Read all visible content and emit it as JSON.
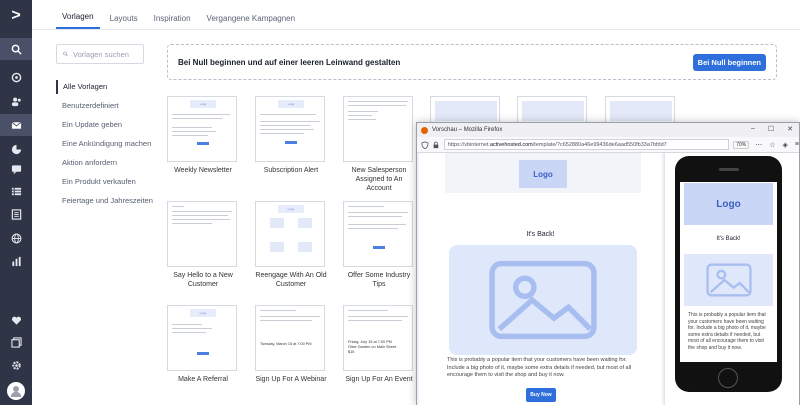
{
  "nav": {
    "logo_glyph": ">",
    "icons": [
      "search-icon",
      "rocket-icon",
      "contacts-icon",
      "mail-icon",
      "automation-icon",
      "conversations-icon",
      "lists-icon",
      "forms-icon",
      "site-icon",
      "reports-icon",
      "favorites-icon",
      "pages-icon",
      "settings-icon",
      "avatar-icon"
    ]
  },
  "tabs": [
    "Vorlagen",
    "Layouts",
    "Inspiration",
    "Vergangene Kampagnen"
  ],
  "search": {
    "placeholder": "Vorlagen suchen"
  },
  "categories": [
    "Alle Vorlagen",
    "Benutzerdefiniert",
    "Ein Update geben",
    "Eine Ankündigung machen",
    "Aktion anfordern",
    "Ein Produkt verkaufen",
    "Feiertage und Jahreszeiten"
  ],
  "banner": {
    "text": "Bei Null beginnen und auf einer leeren Leinwand gestalten",
    "button": "Bei Null beginnen"
  },
  "templates": [
    {
      "label": "Weekly Newsletter"
    },
    {
      "label": "Subscription Alert"
    },
    {
      "label": "New Salesperson Assigned to An Account"
    },
    {
      "label": "Say Hello to a New Customer"
    },
    {
      "label": "Reengage With An Old Customer"
    },
    {
      "label": "Offer Some Industry Tips"
    },
    {
      "label": "Make A Referral"
    },
    {
      "label": "Sign Up For A Webinar"
    },
    {
      "label": "Sign Up For An Event"
    }
  ],
  "thumb": {
    "logo": "Logo",
    "webinar_date": "Tuesday, March 15 at 7:00 PM",
    "event_date": "Friday, July 15 at 7:00 PM",
    "event_place": "Olive Garden on Main Street",
    "event_price": "$15"
  },
  "browser": {
    "title": "Vorschau – Mozilla Firefox",
    "url_prefix": "https://vbinternet.",
    "url_host": "activehosted.com",
    "url_rest": "/template/?c652880a46e99436de6aad550fb33a7bfdd7",
    "zoom": "70%",
    "min": "–",
    "max": "☐",
    "close": "✕"
  },
  "preview": {
    "logo": "Logo",
    "headline": "It's Back!",
    "description": "This is probably a popular item that your customers have been waiting for. Include a big photo of it, maybe some extra details if needed, but most of all encourage them to visit the shop and buy it now.",
    "buy_button": "Buy Now"
  },
  "colors": {
    "nav_bg": "#2f3447",
    "accent": "#2e6fdc",
    "placeholder_blue": "#dfe7fb"
  }
}
